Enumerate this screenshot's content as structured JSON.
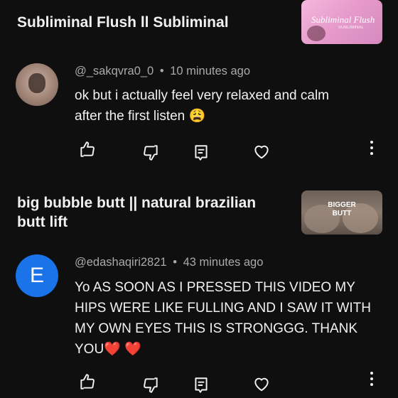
{
  "comments": [
    {
      "video_title": "Subliminal Flush ll Subliminal",
      "thumbnail_text": "Subliminal Flush",
      "thumbnail_subtext": "SUBLIMINAL",
      "username": "@_sakqvra0_0",
      "time": "10 minutes ago",
      "separator": "•",
      "text_lines": [
        "ok but i actually feel very relaxed and calm",
        "after the first listen 😩"
      ],
      "avatar_initial": ""
    },
    {
      "video_title_lines": [
        "big bubble butt || natural brazilian",
        "butt lift"
      ],
      "thumbnail_text_lines": [
        "BIGGER",
        "BUTT"
      ],
      "username": "@edashaqiri2821",
      "time": "43 minutes ago",
      "separator": "•",
      "text_lines": [
        "Yo AS SOON AS I PRESSED THIS VIDEO MY",
        "HIPS WERE LIKE FULLING AND I SAW IT WITH",
        "MY OWN EYES THIS IS STRONGGG. THANK",
        "YOU❤️ ❤️"
      ],
      "avatar_initial": "E",
      "avatar_color": "#1a73e8"
    }
  ],
  "icons": [
    "like-icon",
    "dislike-icon",
    "reply-icon",
    "heart-icon",
    "more-vert-icon"
  ]
}
